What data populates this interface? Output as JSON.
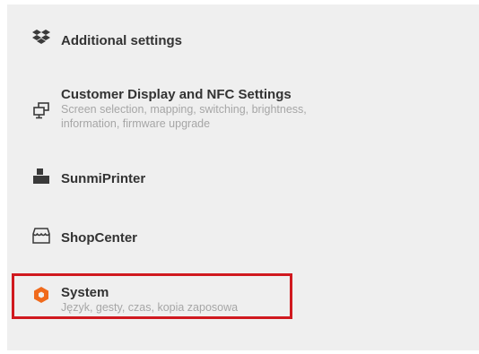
{
  "items": [
    {
      "icon": "dropbox-icon",
      "title": "Additional settings",
      "subtitle": ""
    },
    {
      "icon": "dual-display-icon",
      "title": "Customer Display and NFC Settings",
      "subtitle": "Screen selection, mapping, switching, brightness, information, firmware upgrade"
    },
    {
      "icon": "printer-icon",
      "title": "SunmiPrinter",
      "subtitle": ""
    },
    {
      "icon": "shop-icon",
      "title": "ShopCenter",
      "subtitle": ""
    },
    {
      "icon": "system-hexagon-icon",
      "title": "System",
      "subtitle": "Język, gesty, czas, kopia zaposowa"
    }
  ],
  "colors": {
    "background": "#efefef",
    "title": "#333333",
    "subtitle": "#a6a6a6",
    "icon": "#3a3a3a",
    "accent": "#f06a1c",
    "highlight": "#d0191f"
  }
}
